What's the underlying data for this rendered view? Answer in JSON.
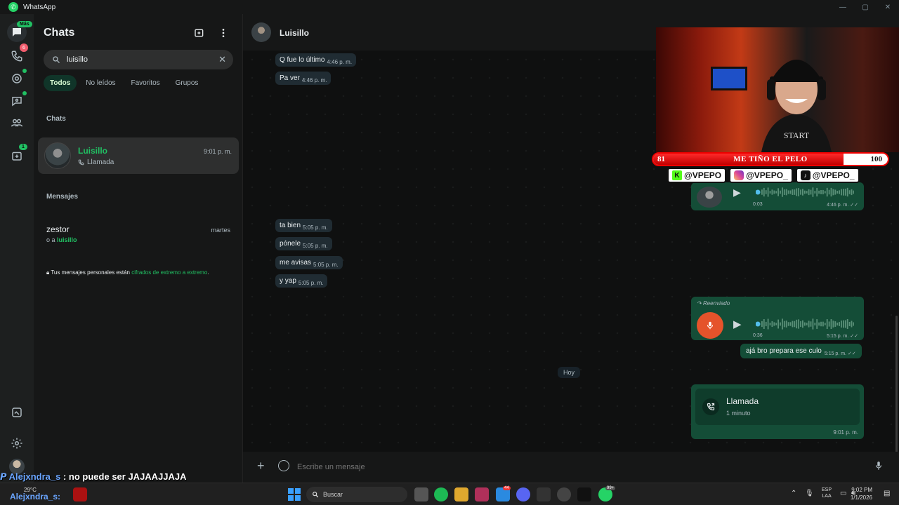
{
  "window": {
    "title": "WhatsApp",
    "minimize": "—",
    "maximize": "▢",
    "close": "✕"
  },
  "rail": {
    "chats_badge": "Más",
    "calls_badge": "6",
    "communities_badge": "1"
  },
  "sidebar": {
    "title": "Chats",
    "search": {
      "value": "luisillo",
      "placeholder": "Buscar"
    },
    "filters": [
      "Todos",
      "No leídos",
      "Favoritos",
      "Grupos"
    ],
    "chats_section": "Chats",
    "chat": {
      "name": "Luisillo",
      "time": "9:01 p. m.",
      "preview": "Llamada"
    },
    "messages_section": "Mensajes",
    "message_result": {
      "name": "zestor",
      "date": "martes",
      "prefix": "o a ",
      "match": "luisillo"
    },
    "e2e_prefix": "Tus mensajes personales están ",
    "e2e_link": "cifrados de extremo a extremo",
    "e2e_suffix": "."
  },
  "conversation": {
    "contact": "Luisillo",
    "incoming_top": [
      {
        "text": "Q fue lo último",
        "time": "4:46 p. m."
      },
      {
        "text": "Pa ver",
        "time": "4:46 p. m."
      }
    ],
    "voice_top": {
      "duration": "0:03",
      "time": "4:46 p. m."
    },
    "incoming_mid": [
      {
        "text": "ta bien",
        "time": "5:05 p. m."
      },
      {
        "text": "pónele",
        "time": "5:05 p. m."
      },
      {
        "text": "me avisas",
        "time": "5:05 p. m."
      },
      {
        "text": "y yap",
        "time": "5:05 p. m."
      }
    ],
    "voice_forwarded": {
      "label": "Reenviado",
      "duration": "0:36",
      "time": "5:15 p. m."
    },
    "text_out": {
      "text": "ajá bro prepara ese culo",
      "time": "5:15 p. m."
    },
    "day_chip": "Hoy",
    "call": {
      "title": "Llamada",
      "subtitle": "1 minuto",
      "time": "9:01 p. m."
    },
    "composer_placeholder": "Escribe un mensaje"
  },
  "stream_overlay": {
    "bar_left": "81",
    "bar_text": "ME TIÑO EL PELO",
    "bar_right": "100",
    "bar_progress": 0.81,
    "socials": [
      {
        "icon": "kick",
        "handle": "@VPEPO"
      },
      {
        "icon": "instagram",
        "handle": "@VPEPO_"
      },
      {
        "icon": "tiktok",
        "handle": "@VPEPO_"
      }
    ],
    "chat_user": "Alejxndra_s",
    "chat_message": " : no puede ser JAJAAJJAJA"
  },
  "taskbar": {
    "weather_temp": "29°C",
    "weather_user": "Alejxndra_s:",
    "search": "Buscar",
    "language": "ESP",
    "language_sub": "LAA",
    "time": "9:02 PM",
    "date": "1/1/2026",
    "app_badge_1": "44",
    "app_badge_2": "99+"
  },
  "colors": {
    "accent": "#21c063",
    "bubble_out": "#144d37",
    "bubble_in": "#202c33",
    "recorder": "#e5532b"
  }
}
